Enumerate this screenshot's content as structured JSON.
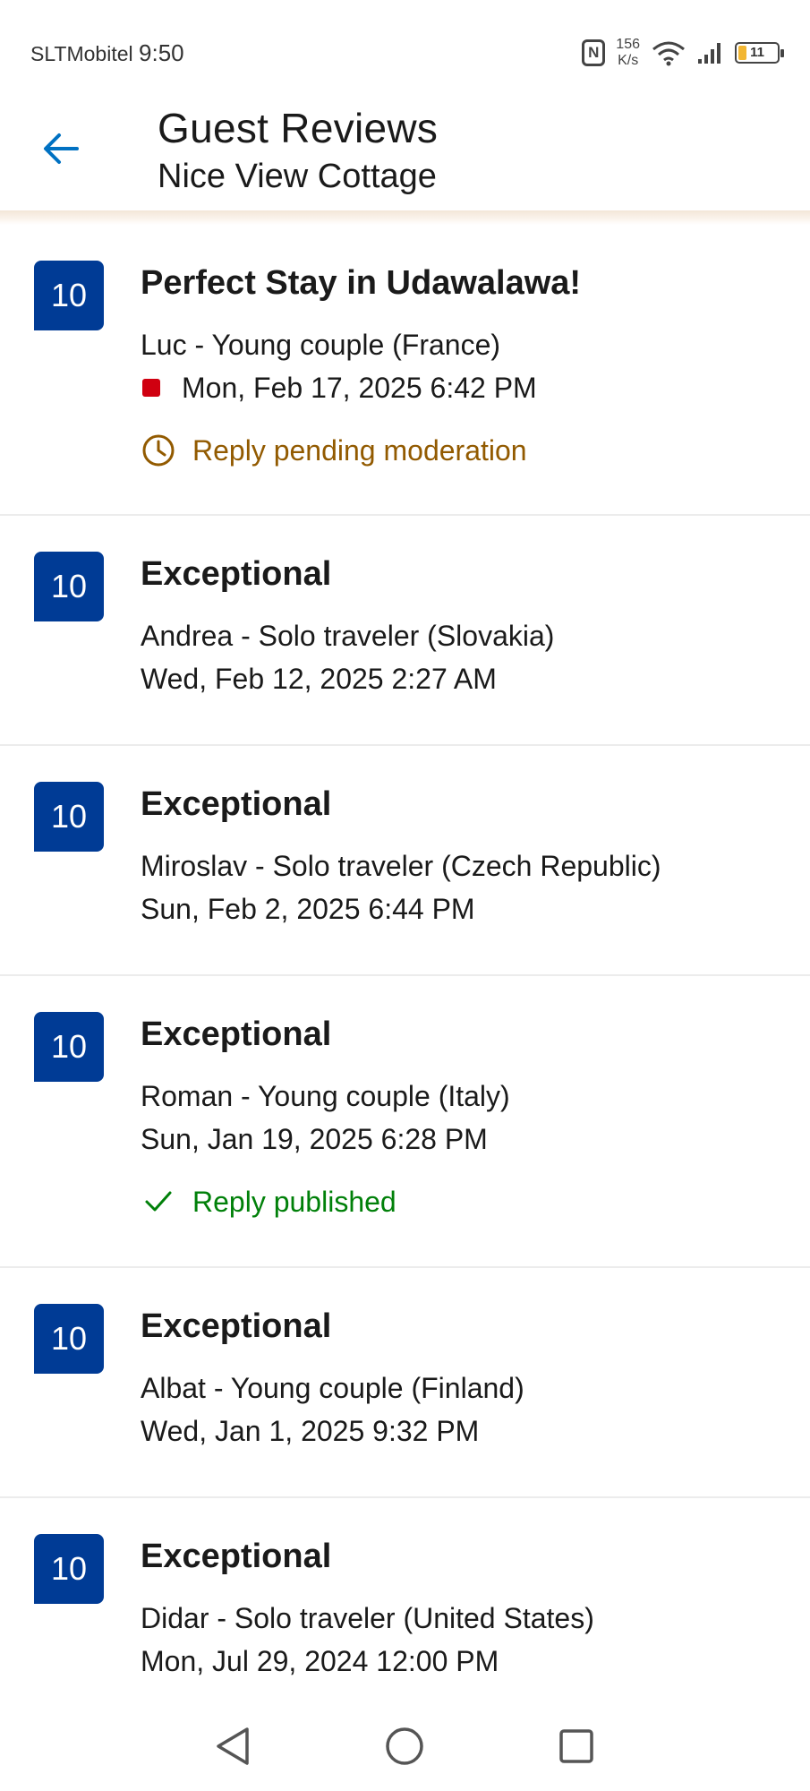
{
  "status_bar": {
    "carrier": "SLTMobitel",
    "time": "9:50",
    "nfc_label": "N",
    "speed_value": "156",
    "speed_unit": "K/s",
    "battery_level": "11",
    "icons": [
      "nfc-icon",
      "wifi-icon",
      "signal-icon",
      "battery-icon"
    ]
  },
  "header": {
    "title": "Guest Reviews",
    "subtitle": "Nice View Cottage",
    "back_icon": "arrow-left-icon"
  },
  "colors": {
    "badge_bg": "#003b95",
    "accent_blue": "#0071c2",
    "pending": "#925a00",
    "published": "#008009",
    "flag_red": "#d00010"
  },
  "reviews": [
    {
      "score": "10",
      "title": "Perfect Stay in Udawalawa!",
      "reviewer": "Luc - Young couple (France)",
      "date": "Mon, Feb 17, 2025 6:42 PM",
      "flagged": true,
      "reply_status": "pending",
      "reply_text": "Reply pending moderation"
    },
    {
      "score": "10",
      "title": "Exceptional",
      "reviewer": "Andrea - Solo traveler (Slovakia)",
      "date": "Wed, Feb 12, 2025 2:27 AM"
    },
    {
      "score": "10",
      "title": "Exceptional",
      "reviewer": "Miroslav - Solo traveler (Czech Republic)",
      "date": "Sun, Feb 2, 2025 6:44 PM"
    },
    {
      "score": "10",
      "title": "Exceptional",
      "reviewer": "Roman - Young couple (Italy)",
      "date": "Sun, Jan 19, 2025 6:28 PM",
      "reply_status": "published",
      "reply_text": "Reply published"
    },
    {
      "score": "10",
      "title": "Exceptional",
      "reviewer": "Albat - Young couple (Finland)",
      "date": "Wed, Jan 1, 2025 9:32 PM"
    },
    {
      "score": "10",
      "title": "Exceptional",
      "reviewer": "Didar - Solo traveler (United States)",
      "date": "Mon, Jul 29, 2024 12:00 PM"
    }
  ],
  "nav_bar": {
    "items": [
      "back-triangle-icon",
      "home-circle-icon",
      "recents-square-icon"
    ]
  }
}
